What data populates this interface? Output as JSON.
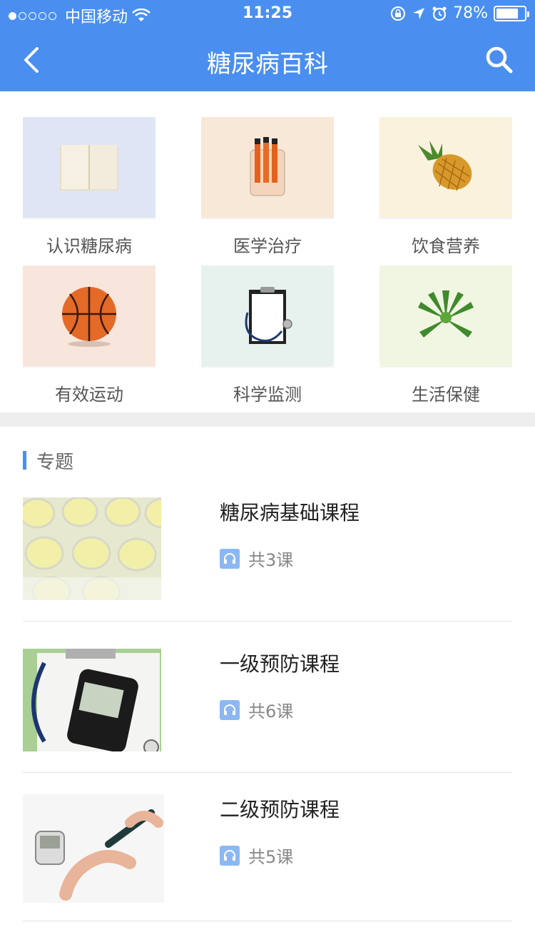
{
  "status_bar": {
    "carrier": "中国移动",
    "time": "11:25",
    "battery": "78%",
    "battery_level": 0.78
  },
  "nav": {
    "title": "糖尿病百科"
  },
  "categories": [
    {
      "label": "认识糖尿病",
      "icon": "open-book-icon",
      "bg": "#dfe5f5"
    },
    {
      "label": "医学治疗",
      "icon": "test-tubes-icon",
      "bg": "#f8e8d8"
    },
    {
      "label": "饮食营养",
      "icon": "pineapple-icon",
      "bg": "#faf2dd"
    },
    {
      "label": "有效运动",
      "icon": "basketball-icon",
      "bg": "#f8e6dc"
    },
    {
      "label": "科学监测",
      "icon": "clipboard-stethoscope-icon",
      "bg": "#e7f2ef"
    },
    {
      "label": "生活保健",
      "icon": "aloe-plant-icon",
      "bg": "#f1f6e2"
    }
  ],
  "section": {
    "title": "专题"
  },
  "courses": [
    {
      "title": "糖尿病基础课程",
      "count": "共3课",
      "image": "test-tray-image"
    },
    {
      "title": "一级预防课程",
      "count": "共6课",
      "image": "glucose-meter-image"
    },
    {
      "title": "二级预防课程",
      "count": "共5课",
      "image": "finger-prick-image"
    }
  ],
  "colors": {
    "brand": "#4a8ff0",
    "headphone_badge": "#8cb8f2"
  }
}
